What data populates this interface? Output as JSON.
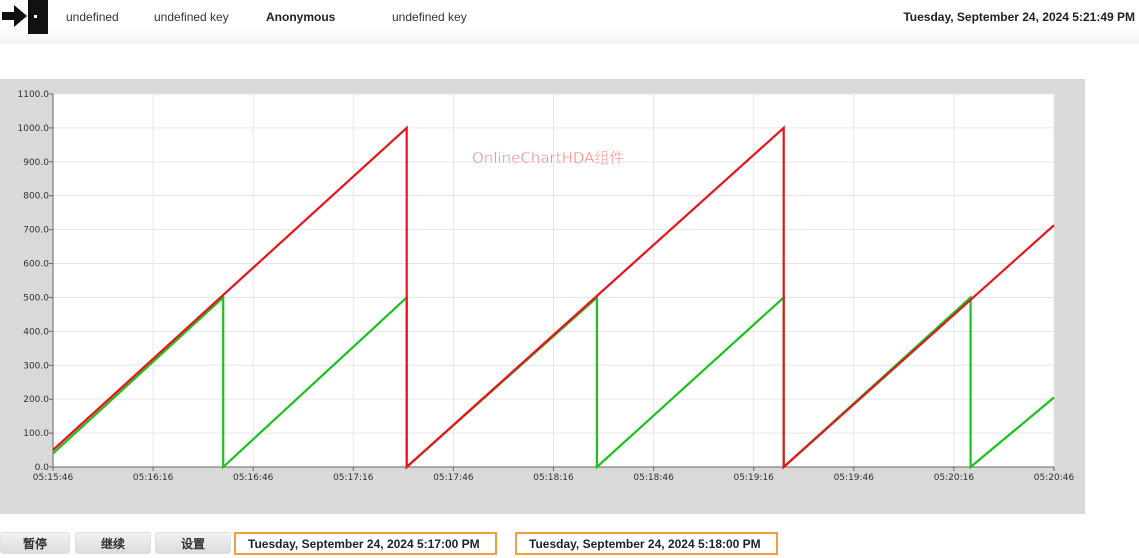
{
  "header": {
    "item1": "undefined",
    "item2": "undefined key",
    "user": "Anonymous",
    "item4": "undefined key",
    "datetime": "Tuesday, September 24, 2024 5:21:49 PM"
  },
  "chart_data": {
    "type": "line",
    "watermark": "OnlineChartHDA组件",
    "x_ticks": [
      "05:15:46",
      "05:16:16",
      "05:16:46",
      "05:17:16",
      "05:17:46",
      "05:18:16",
      "05:18:46",
      "05:19:16",
      "05:19:46",
      "05:20:16",
      "05:20:46"
    ],
    "y_ticks": [
      "0.0",
      "100.0",
      "200.0",
      "300.0",
      "400.0",
      "500.0",
      "600.0",
      "700.0",
      "800.0",
      "900.0",
      "1000.0",
      "1100.0"
    ],
    "xlim": [
      0,
      300
    ],
    "ylim": [
      0,
      1100
    ],
    "grid": true,
    "colors": {
      "red": "#e8141b",
      "green": "#19c21c"
    },
    "series": [
      {
        "color": "red",
        "points": [
          [
            0,
            50
          ],
          [
            106,
            1000
          ],
          [
            106,
            0
          ],
          [
            219,
            1000
          ],
          [
            219,
            0
          ],
          [
            300,
            713
          ]
        ]
      },
      {
        "color": "green",
        "points": [
          [
            0,
            40
          ],
          [
            51,
            500
          ],
          [
            51,
            0
          ],
          [
            106,
            500
          ],
          [
            106,
            0
          ],
          [
            163,
            500
          ],
          [
            163,
            0
          ],
          [
            219,
            500
          ],
          [
            219,
            0
          ],
          [
            275,
            500
          ],
          [
            275,
            0
          ],
          [
            300,
            205
          ]
        ]
      }
    ]
  },
  "footer": {
    "pause_label": "暂停",
    "continue_label": "继续",
    "settings_label": "设置",
    "start_time": "Tuesday, September 24, 2024 5:17:00 PM",
    "end_time": "Tuesday, September 24, 2024 5:18:00 PM"
  }
}
